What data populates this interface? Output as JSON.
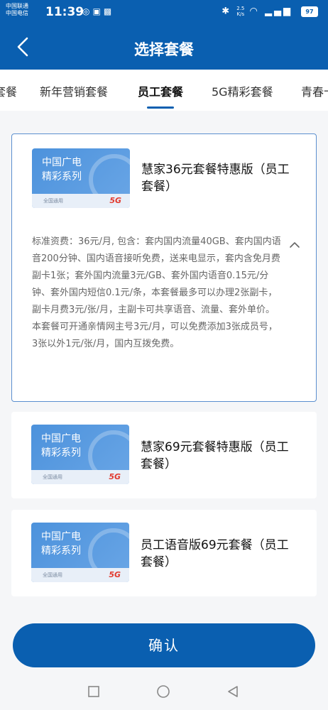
{
  "status_bar": {
    "carrier_line1": "中国联通",
    "carrier_line2": "中国电信",
    "time": "11:39",
    "net_speed_value": "2.5",
    "net_speed_unit": "K/s",
    "battery": "97"
  },
  "header": {
    "title": "选择套餐",
    "back_icon": "chevron-left-icon"
  },
  "tabs": [
    {
      "label": "套餐",
      "active": false
    },
    {
      "label": "新年营销套餐",
      "active": false
    },
    {
      "label": "员工套餐",
      "active": true
    },
    {
      "label": "5G精彩套餐",
      "active": false
    },
    {
      "label": "青春卡",
      "active": false
    }
  ],
  "plans": [
    {
      "image_series_line1": "中国广电",
      "image_series_line2": "精彩系列",
      "image_strip_text": "全国通用",
      "image_badge": "5G",
      "name": "慧家36元套餐特惠版（员工套餐）",
      "selected": true,
      "expanded": true,
      "description": "标准资费：36元/月, 包含：套内国内流量40GB、套内国内语音200分钟、国内语音接听免费，送来电显示，套内含免月费副卡1张；套外国内流量3元/GB、套外国内语音0.15元/分钟、套外国内短信0.1元/条，本套餐最多可以办理2张副卡，副卡月费3元/张/月，主副卡可共享语音、流量、套外单价。本套餐可开通亲情网主号3元/月，可以免费添加3张成员号，3张以外1元/张/月，国内互拨免费。"
    },
    {
      "image_series_line1": "中国广电",
      "image_series_line2": "精彩系列",
      "image_strip_text": "全国通用",
      "image_badge": "5G",
      "name": "慧家69元套餐特惠版（员工套餐）",
      "selected": false,
      "expanded": false
    },
    {
      "image_series_line1": "中国广电",
      "image_series_line2": "精彩系列",
      "image_strip_text": "全国通用",
      "image_badge": "5G",
      "name": "员工语音版69元套餐（员工套餐）",
      "selected": false,
      "expanded": false
    }
  ],
  "footer": {
    "confirm_label": "确认"
  },
  "colors": {
    "brand_blue": "#0a5fb0",
    "selected_border": "#5b8fcf",
    "badge_5g": "#e23a2e"
  }
}
